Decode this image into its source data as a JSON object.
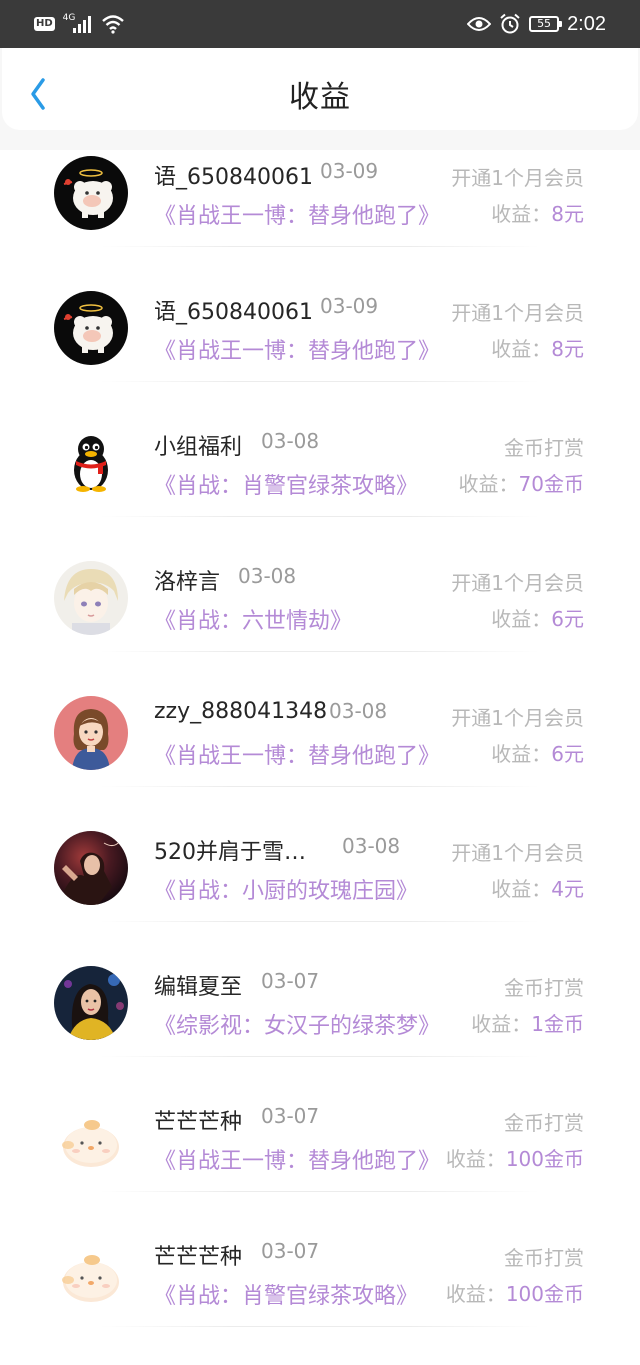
{
  "status_bar": {
    "hd": "HD",
    "network": "4G",
    "battery": "55",
    "time": "2:02"
  },
  "header": {
    "title": "收益",
    "back_icon": "chevron-left-icon"
  },
  "colors": {
    "accent": "#b48ad6",
    "back_icon": "#2a9be6",
    "muted": "#b8b8b8"
  },
  "records": [
    {
      "name": "语_650840061",
      "date": "03-09",
      "book": "《肖战王一博：替身他跑了》",
      "type": "开通1个月会员",
      "earn_label": "收益：",
      "earn_value": "8元",
      "avatar": "sheep-avatar"
    },
    {
      "name": "语_650840061",
      "date": "03-09",
      "book": "《肖战王一博：替身他跑了》",
      "type": "开通1个月会员",
      "earn_label": "收益：",
      "earn_value": "8元",
      "avatar": "sheep-avatar"
    },
    {
      "name": "小组福利",
      "date": "03-08",
      "book": "《肖战：肖警官绿茶攻略》",
      "type": "金币打赏",
      "earn_label": "收益：",
      "earn_value": "70金币",
      "avatar": "penguin-avatar"
    },
    {
      "name": "洛梓言",
      "date": "03-08",
      "book": "《肖战：六世情劫》",
      "type": "开通1个月会员",
      "earn_label": "收益：",
      "earn_value": "6元",
      "avatar": "anime-boy-avatar"
    },
    {
      "name": "zzy_888041348",
      "date": "03-08",
      "book": "《肖战王一博：替身他跑了》",
      "type": "开通1个月会员",
      "earn_label": "收益：",
      "earn_value": "6元",
      "avatar": "cartoon-girl-avatar"
    },
    {
      "name": "520并肩于雪…",
      "date": "03-08",
      "book": "《肖战：小厨的玫瑰庄园》",
      "type": "开通1个月会员",
      "earn_label": "收益：",
      "earn_value": "4元",
      "avatar": "dark-art-avatar"
    },
    {
      "name": "编辑夏至",
      "date": "03-07",
      "book": "《综影视：女汉子的绿茶梦》",
      "type": "金币打赏",
      "earn_label": "收益：",
      "earn_value": "1金币",
      "avatar": "photo-girl-avatar"
    },
    {
      "name": "芒芒芒种",
      "date": "03-07",
      "book": "《肖战王一博：替身他跑了》",
      "type": "金币打赏",
      "earn_label": "收益：",
      "earn_value": "100金币",
      "avatar": "chick-avatar"
    },
    {
      "name": "芒芒芒种",
      "date": "03-07",
      "book": "《肖战：肖警官绿茶攻略》",
      "type": "金币打赏",
      "earn_label": "收益：",
      "earn_value": "100金币",
      "avatar": "chick-avatar"
    }
  ]
}
